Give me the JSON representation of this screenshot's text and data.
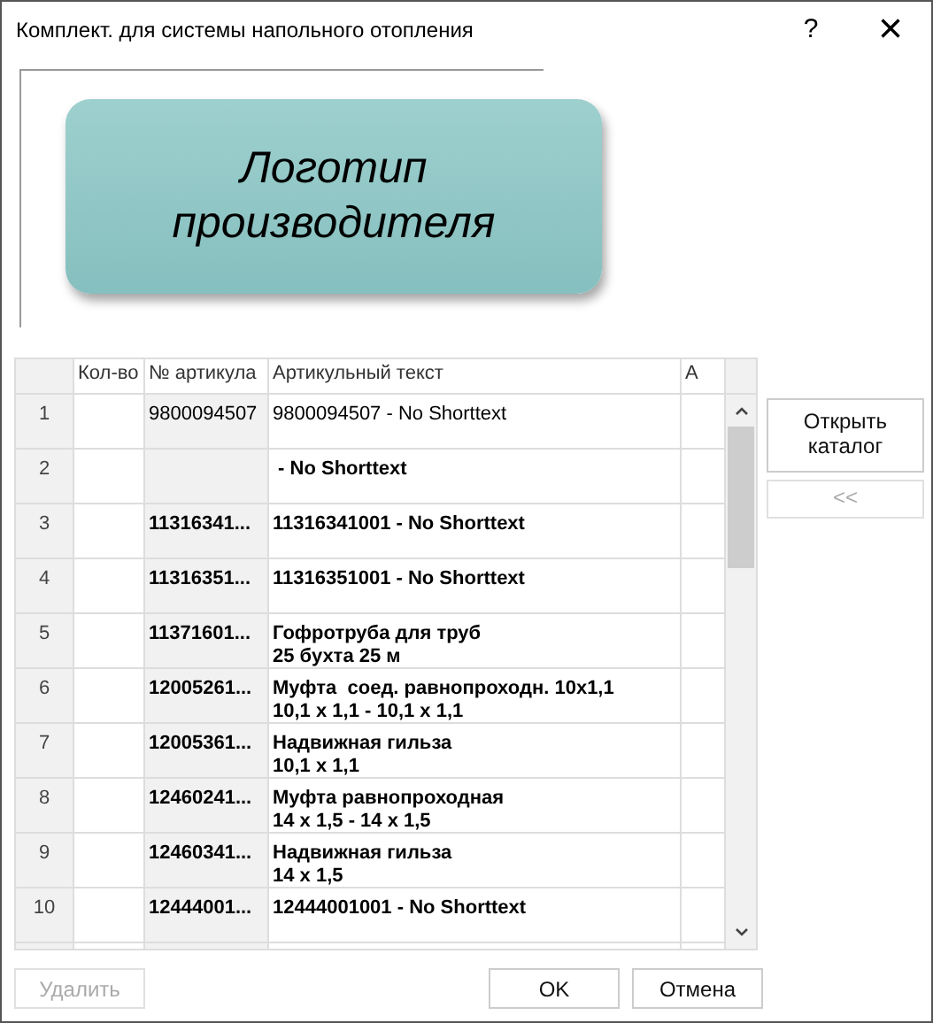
{
  "window": {
    "title": "Комплект. для системы напольного отопления",
    "help": "?",
    "close": "×"
  },
  "logo": {
    "text": "Логотип производителя"
  },
  "table": {
    "columns": [
      "Кол-во",
      "№ артикула",
      "Артикульный текст",
      "A"
    ],
    "rows": [
      {
        "num": "1",
        "qty": "",
        "article": "9800094507",
        "text": "9800094507 - No Shorttext",
        "bold": false
      },
      {
        "num": "2",
        "qty": "",
        "article": "",
        "text": " - No Shorttext",
        "bold": true
      },
      {
        "num": "3",
        "qty": "",
        "article": "11316341...",
        "text": "11316341001 - No Shorttext",
        "bold": true
      },
      {
        "num": "4",
        "qty": "",
        "article": "11316351...",
        "text": "11316351001 - No Shorttext",
        "bold": true
      },
      {
        "num": "5",
        "qty": "",
        "article": "11371601...",
        "text": "Гофротруба для труб\n25 бухта 25 м",
        "bold": true
      },
      {
        "num": "6",
        "qty": "",
        "article": "12005261...",
        "text": "Муфта  соед. равнопроходн. 10x1,1\n10,1 x 1,1 - 10,1 x 1,1",
        "bold": true
      },
      {
        "num": "7",
        "qty": "",
        "article": "12005361...",
        "text": "Надвижная гильза\n10,1 x 1,1",
        "bold": true
      },
      {
        "num": "8",
        "qty": "",
        "article": "12460241...",
        "text": "Муфта равнопроходная\n14 x 1,5 - 14 x 1,5",
        "bold": true
      },
      {
        "num": "9",
        "qty": "",
        "article": "12460341...",
        "text": "Надвижная гильза\n14 x 1,5",
        "bold": true
      },
      {
        "num": "10",
        "qty": "",
        "article": "12444001...",
        "text": "12444001001 - No Shorttext",
        "bold": true
      }
    ]
  },
  "side_buttons": [
    {
      "label": "Открыть\nкаталог",
      "disabled": false
    },
    {
      "label": "<<",
      "disabled": true
    }
  ],
  "footer": {
    "delete": {
      "label": "Удалить",
      "disabled": true
    },
    "ok": {
      "label": "OK",
      "disabled": false
    },
    "cancel": {
      "label": "Отмена",
      "disabled": false
    }
  }
}
